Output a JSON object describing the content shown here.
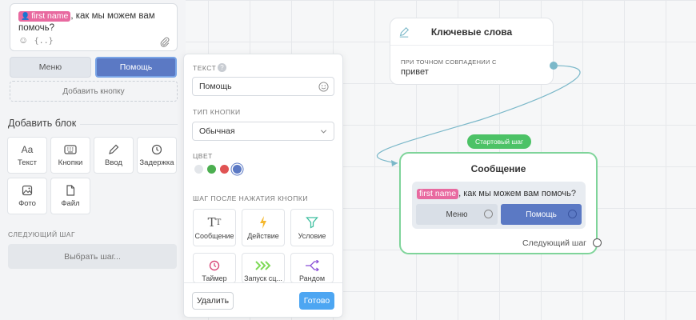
{
  "editor": {
    "variable_chip": "first name",
    "text_after": ", как мы можем вам помочь?",
    "emoji_icon": "smile-icon",
    "variable_icon": "braces-icon",
    "attach_icon": "paperclip-icon"
  },
  "buttons": {
    "menu_label": "Меню",
    "help_label": "Помощь",
    "add_label": "Добавить кнопку"
  },
  "add_block": {
    "title": "Добавить блок",
    "tiles": [
      {
        "label": "Текст",
        "icon": "text-icon"
      },
      {
        "label": "Кнопки",
        "icon": "keyboard-icon"
      },
      {
        "label": "Ввод",
        "icon": "pencil-icon"
      },
      {
        "label": "Задержка",
        "icon": "clock-icon"
      },
      {
        "label": "Фото",
        "icon": "image-icon"
      },
      {
        "label": "Файл",
        "icon": "file-icon"
      }
    ]
  },
  "next_step": {
    "title": "СЛЕДУЮЩИЙ ШАГ",
    "choose_label": "Выбрать шаг..."
  },
  "popup": {
    "text_label": "ТЕКСТ",
    "text_value": "Помощь",
    "type_label": "ТИП КНОПКИ",
    "type_value": "Обычная",
    "color_label": "ЦВЕТ",
    "colors": [
      "#e3e6ea",
      "#4caf50",
      "#e05353",
      "#5b79c4"
    ],
    "selected_color": "#5b79c4",
    "step_label": "ШАГ ПОСЛЕ НАЖАТИЯ КНОПКИ",
    "actions": [
      {
        "label": "Сообщение",
        "icon": "text-type-icon",
        "color": "#555555"
      },
      {
        "label": "Действие",
        "icon": "lightning-icon",
        "color": "#f5b82e"
      },
      {
        "label": "Условие",
        "icon": "filter-icon",
        "color": "#3fbfa0"
      },
      {
        "label": "Таймер",
        "icon": "timer-icon",
        "color": "#d94a7a"
      },
      {
        "label": "Запуск сц...",
        "icon": "chevrons-right-icon",
        "color": "#7ed957"
      },
      {
        "label": "Рандом",
        "icon": "split-icon",
        "color": "#8a4fd6"
      }
    ],
    "delete_label": "Удалить",
    "done_label": "Готово"
  },
  "keywords_node": {
    "title": "Ключевые слова",
    "match_label": "ПРИ ТОЧНОМ СОВПАДЕНИИ С",
    "match_value": "привет"
  },
  "message_node": {
    "start_badge": "Стартовый шаг",
    "title": "Сообщение",
    "variable_chip": "first name",
    "text_after": ", как мы можем вам помочь?",
    "btn_menu": "Меню",
    "btn_help": "Помощь",
    "next_step": "Следующий шаг"
  }
}
